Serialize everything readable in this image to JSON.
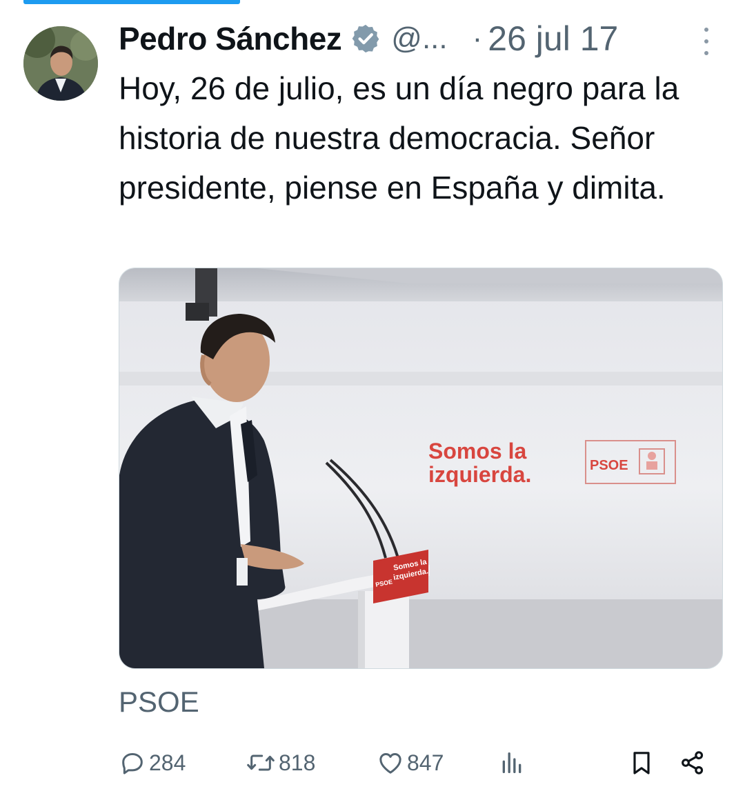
{
  "tweet": {
    "author_name": "Pedro Sánchez",
    "handle": "@...",
    "separator": "·",
    "date": "26 jul 17",
    "text": "Hoy, 26 de julio, es un día negro para la historia de nuestra democracia. Señor presidente, piense en España y dimita.",
    "media": {
      "backdrop_slogan_line1": "Somos la",
      "backdrop_slogan_line2": "izquierda.",
      "backdrop_logo": "PSOE",
      "podium_slogan_line1": "Somos la",
      "podium_slogan_line2": "izquierda.",
      "podium_logo": "PSOE"
    },
    "source_label": "PSOE",
    "actions": {
      "replies": "284",
      "retweets": "818",
      "likes": "847"
    }
  },
  "icons": {
    "verified": "verified-badge-icon",
    "more": "more-vertical-icon",
    "reply": "reply-icon",
    "retweet": "retweet-icon",
    "like": "heart-icon",
    "views": "views-icon",
    "bookmark": "bookmark-icon",
    "share": "share-icon"
  },
  "colors": {
    "accent": "#1d9bf0",
    "secondary_text": "#536471",
    "verified_badge": "#829aab",
    "psoe_red": "#d8463f"
  }
}
